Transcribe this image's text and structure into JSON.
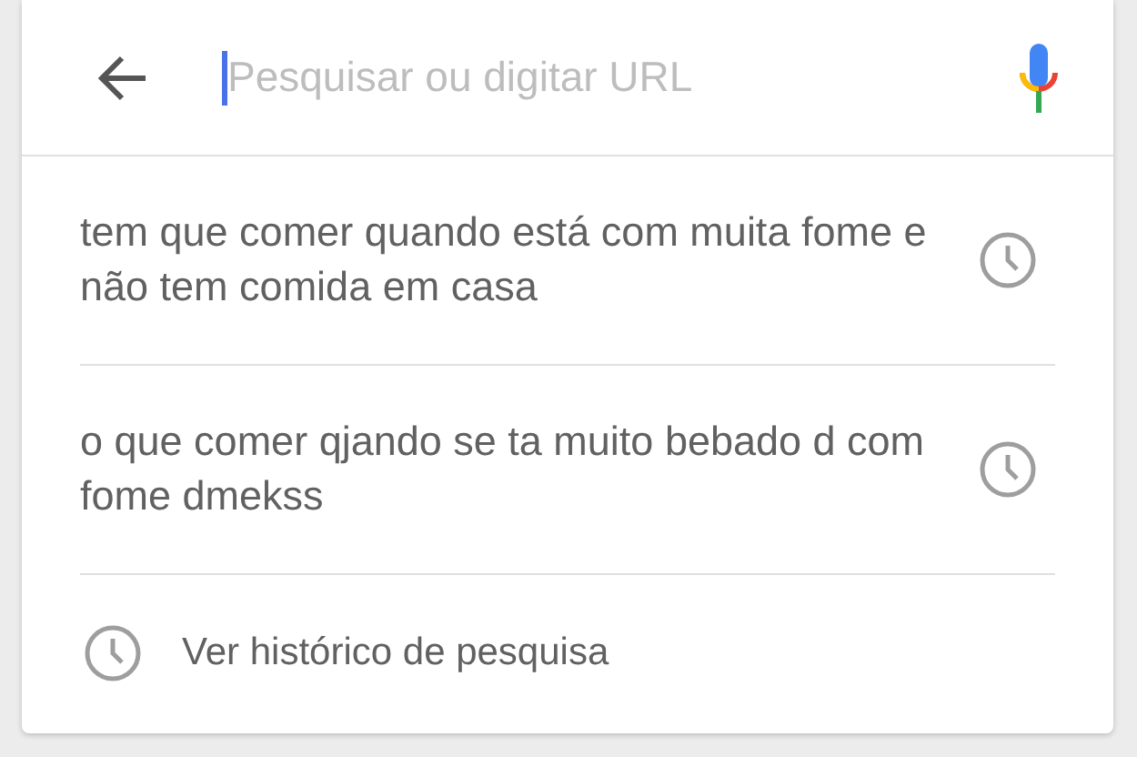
{
  "search": {
    "placeholder": "Pesquisar ou digitar URL"
  },
  "suggestions": [
    {
      "text": "tem que comer quando está com muita fome e não tem comida em casa"
    },
    {
      "text": "o que comer qjando se ta muito bebado d com fome dmekss"
    }
  ],
  "history_link": "Ver histórico de pesquisa"
}
